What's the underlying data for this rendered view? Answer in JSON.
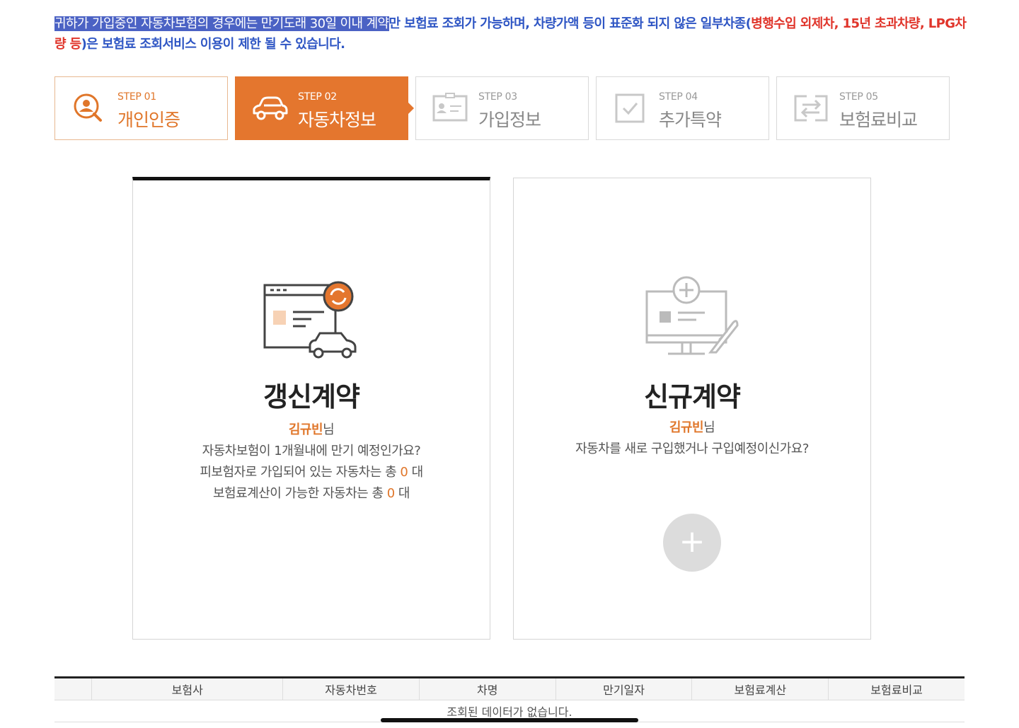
{
  "notice": {
    "highlighted": "귀하가 가입중인 자동차보험의 경우에는 만기도래 30일 이내 계약",
    "blue1": "만 보험료 조회가 가능하며, 차량가액 등이 표준화 되지 않은 일부차종(",
    "red": "병행수입 외제차, 15년 초과차량, LPG차량 등",
    "blue2": ")은 보험료 조회서비스 이용이 제한 될 수 있습니다."
  },
  "steps": [
    {
      "no": "STEP 01",
      "name": "개인인증",
      "icon": "user-search-icon",
      "state": "done"
    },
    {
      "no": "STEP 02",
      "name": "자동차정보",
      "icon": "car-icon",
      "state": "active"
    },
    {
      "no": "STEP 03",
      "name": "가입정보",
      "icon": "id-card-icon",
      "state": "todo"
    },
    {
      "no": "STEP 04",
      "name": "추가특약",
      "icon": "checkbox-icon",
      "state": "todo"
    },
    {
      "no": "STEP 05",
      "name": "보험료비교",
      "icon": "compare-icon",
      "state": "todo"
    }
  ],
  "renew": {
    "title": "갱신계약",
    "user_name": "김규빈",
    "honorific": "님",
    "line1": "자동차보험이 1개월내에 만기 예정인가요?",
    "line2_prefix": "피보험자로 가입되어 있는 자동차는 총 ",
    "line2_count": "0",
    "line2_suffix": " 대",
    "line3_prefix": "보험료계산이 가능한 자동차는 총 ",
    "line3_count": "0",
    "line3_suffix": " 대"
  },
  "new_contract": {
    "title": "신규계약",
    "user_name": "김규빈",
    "honorific": "님",
    "line1": "자동차를 새로 구입했거나 구입예정이신가요?",
    "plus": "+"
  },
  "table": {
    "headers": [
      "",
      "보험사",
      "자동차번호",
      "차명",
      "만기일자",
      "보험료계산",
      "보험료비교"
    ],
    "empty_message": "조회된 데이터가 없습니다."
  },
  "colors": {
    "accent": "#e4762e",
    "notice_blue": "#2f56c4",
    "notice_red": "#e0352b"
  }
}
